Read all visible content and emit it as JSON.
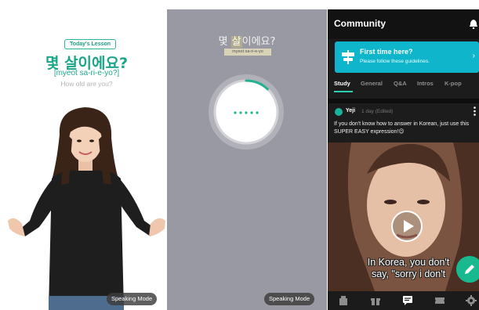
{
  "lesson": {
    "badge": "Today's Lesson",
    "korean": "몇 살이에요?",
    "romanization": "[myeot sa-ri-e-yo?]",
    "english": "How old are you?",
    "mode_button": "Speaking Mode"
  },
  "speaking": {
    "korean_plain": "몇 ",
    "korean_highlight": "살",
    "korean_rest": "이에요?",
    "romanization": "myeot sa-ri-e-yo",
    "progress_fraction": 0.12,
    "mode_button": "Speaking Mode"
  },
  "community": {
    "title": "Community",
    "guide_title": "First time here?",
    "guide_subtitle": "Please follow these guidelines.",
    "tabs": [
      {
        "label": "Study",
        "active": true
      },
      {
        "label": "General",
        "active": false
      },
      {
        "label": "Q&A",
        "active": false
      },
      {
        "label": "Intros",
        "active": false
      },
      {
        "label": "K-pop",
        "active": false
      }
    ],
    "post": {
      "user": "Yeji",
      "meta": "1 day (Edited)",
      "text": "If you don't know how to answer in Korean, just use this SUPER EASY expression!😉",
      "caption_line1": "In Korea, you don't",
      "caption_line2": "say, \"sorry i don't"
    },
    "nav_icons": [
      "home-icon",
      "gift-icon",
      "community-icon",
      "ticket-icon",
      "settings-icon"
    ]
  },
  "colors": {
    "accent_teal": "#1aa689",
    "guide_blue": "#0fb5ca",
    "fab_green": "#19b98f",
    "speaking_bg": "#9999a3"
  }
}
